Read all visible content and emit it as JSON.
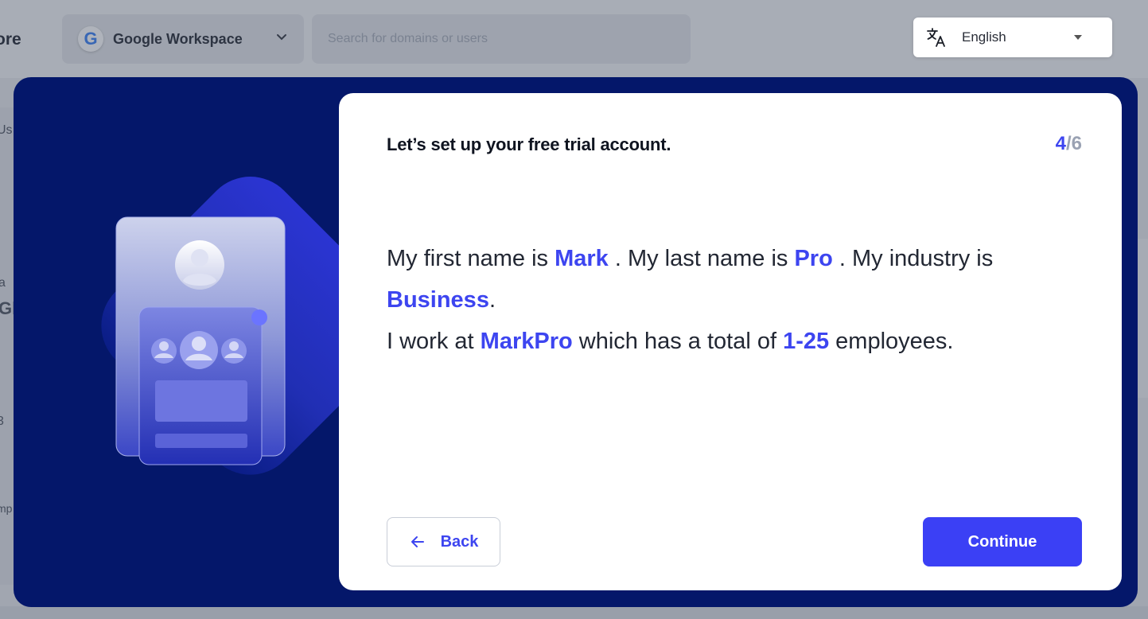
{
  "background": {
    "brand_fragment": "ore",
    "workspace": {
      "logo_letter": "G",
      "label": "Google Workspace"
    },
    "search": {
      "placeholder": "Search for domains or users"
    },
    "side_fragments": [
      "Us",
      "a",
      "Gl",
      "3",
      "mp"
    ]
  },
  "language": {
    "selected": "English"
  },
  "modal": {
    "heading": "Let’s set up your free trial account.",
    "step": {
      "current": "4",
      "separator": "/",
      "total": "6"
    },
    "sentence": {
      "p1": "My first name is ",
      "first_name": "Mark",
      "p2": " . My last name is ",
      "last_name": "Pro",
      "p3": " . My industry is ",
      "industry": "Business",
      "p4": ".",
      "p5": "I work at ",
      "company": "MarkPro",
      "p6": " which has a total of ",
      "employees": "1-25",
      "p7": " employees."
    },
    "buttons": {
      "back": "Back",
      "continue": "Continue"
    }
  },
  "colors": {
    "modal_bg": "#04176a",
    "accent": "#3d45f0",
    "primary_button": "#3b40f5"
  }
}
